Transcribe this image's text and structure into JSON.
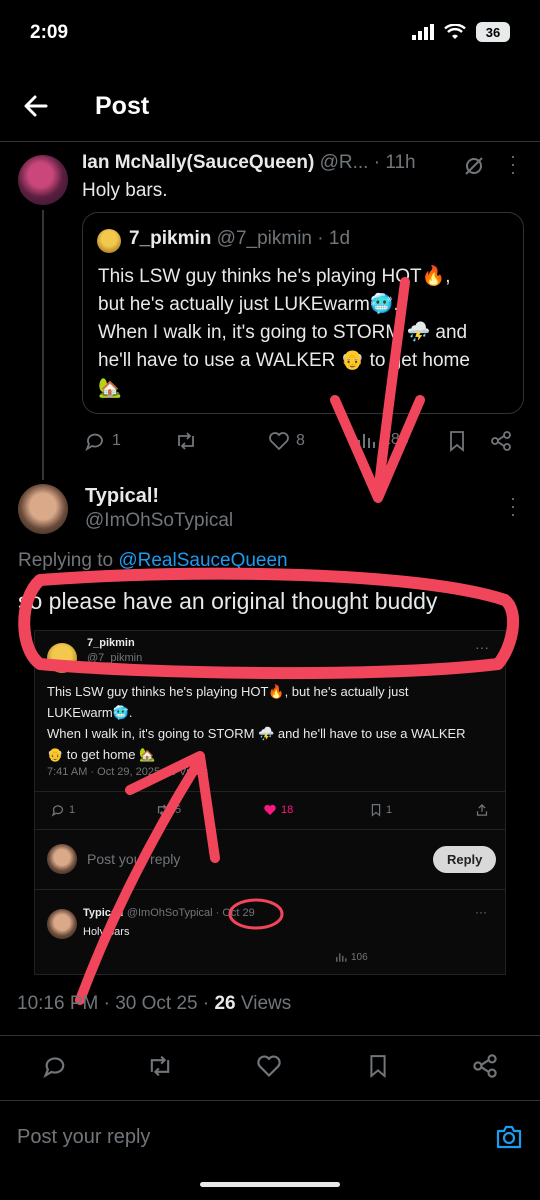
{
  "status": {
    "time": "2:09",
    "battery": "36"
  },
  "header": {
    "title": "Post"
  },
  "parent": {
    "name": "Ian McNally(SauceQueen)",
    "handle": "@R...",
    "time": "· 11h",
    "text": "Holy bars.",
    "quote": {
      "name": "7_pikmin",
      "handle": "@7_pikmin",
      "time": "· 1d",
      "line1": "This LSW guy thinks he's playing HOT🔥,",
      "line2": "but he's actually just LUKEwarm🥶.",
      "line3": "When I walk in, it's going to STORM ⛈️ and",
      "line4": "he'll have to use a WALKER 👴 to get home",
      "line5": "🏡"
    },
    "stats": {
      "replies": "1",
      "likes": "8",
      "views": "288"
    }
  },
  "main": {
    "name": "Typical!",
    "handle": "@ImOhSoTypical",
    "replying_label": "Replying to",
    "replying_to": "@RealSauceQueen",
    "text": "so please have an original thought buddy",
    "footer_time": "10:16 PM · 30 Oct 25 ·",
    "views_count": "26",
    "views_label": "Views"
  },
  "embedded": {
    "name": "7_pikmin",
    "handle": "@7_pikmin",
    "line1": "This LSW guy thinks he's playing HOT🔥, but he's actually just",
    "line2": "LUKEwarm🥶.",
    "line3": "When I walk in, it's going to STORM ⛈️ and he'll have to use a WALKER",
    "line4": "👴 to get home 🏡",
    "meta": "7:41 AM · Oct 29, 2025 · 8",
    "meta_views": "Views",
    "stats": {
      "replies": "1",
      "reposts": "5",
      "likes": "18",
      "bookmarks": "1"
    },
    "reply_placeholder": "Post your reply",
    "reply_button": "Reply",
    "reply_name": "Typical!",
    "reply_handle": "@ImOhSoTypical ·",
    "reply_date": "Oct 29",
    "reply_text": "Holy bars",
    "reply_views": "106"
  },
  "composer": {
    "placeholder": "Post your reply"
  },
  "colors": {
    "background": "#000000",
    "accent": "#1d9bf0",
    "annotation": "#f0455a",
    "like": "#f91880"
  }
}
